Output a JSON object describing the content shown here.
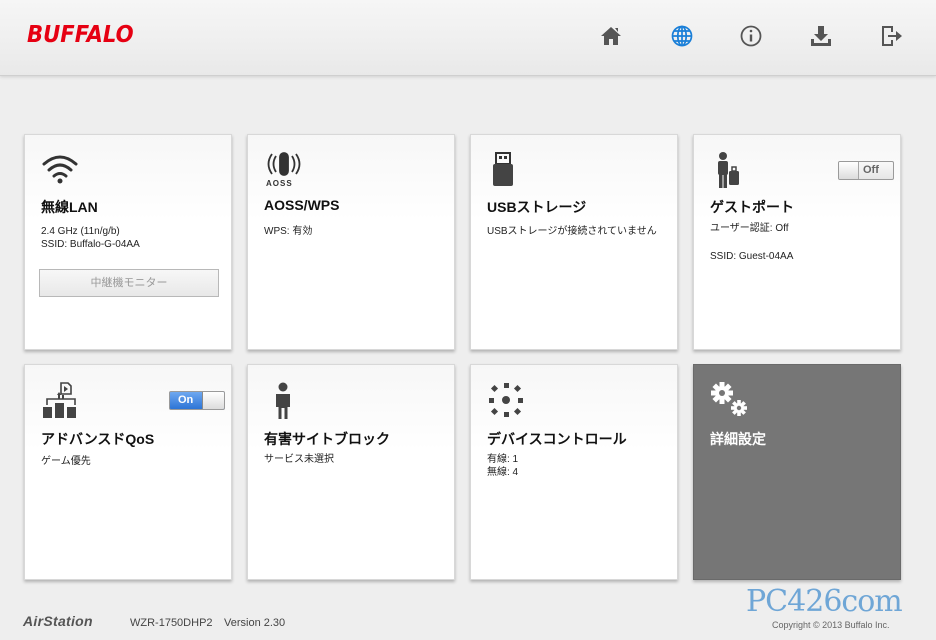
{
  "header": {
    "logo_text": "BUFFALO",
    "nav": [
      {
        "name": "home-icon",
        "color": "#555555"
      },
      {
        "name": "globe-icon",
        "color": "#1a7fd8"
      },
      {
        "name": "info-icon",
        "color": "#555555"
      },
      {
        "name": "download-icon",
        "color": "#555555"
      },
      {
        "name": "logout-icon",
        "color": "#555555"
      }
    ]
  },
  "tiles": {
    "wlan": {
      "title": "無線LAN",
      "line1": "2.4 GHz (11n/g/b)",
      "line2": "SSID: Buffalo-G-04AA",
      "button": "中継機モニター"
    },
    "aoss": {
      "title": "AOSS/WPS",
      "icon_text": "AOSS",
      "line1": "WPS: 有効"
    },
    "usb": {
      "title": "USBストレージ",
      "line1": "USBストレージが接続されていません"
    },
    "guest": {
      "title": "ゲストポート",
      "toggle": "Off",
      "line1": "ユーザー認証: Off",
      "line2": "SSID: Guest-04AA"
    },
    "qos": {
      "title": "アドバンスドQoS",
      "toggle": "On",
      "line1": "ゲーム優先"
    },
    "block": {
      "title": "有害サイトブロック",
      "line1": "サービス未選択"
    },
    "device": {
      "title": "デバイスコントロール",
      "line1": "有線: 1",
      "line2": "無線: 4"
    },
    "advanced": {
      "title": "詳細設定"
    }
  },
  "footer": {
    "brand": "AirStation",
    "model": "WZR-1750DHP2",
    "version": "Version 2.30",
    "watermark": "PC426com",
    "copyright": "Copyright © 2013 Buffalo Inc."
  },
  "colors": {
    "brand_red": "#e60012",
    "toggle_on": "#2c74d6",
    "dark_tile": "#767676"
  }
}
